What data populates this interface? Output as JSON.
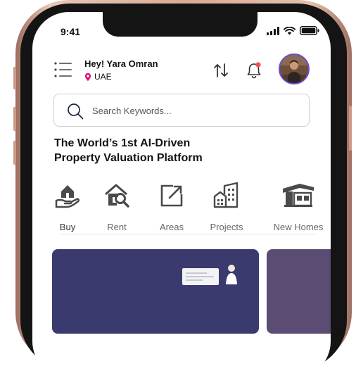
{
  "status_bar": {
    "time": "9:41"
  },
  "header": {
    "greeting": "Hey! Yara Omran",
    "location": "UAE"
  },
  "search": {
    "placeholder": "Search Keywords..."
  },
  "headline": {
    "line1": "The World’s 1st AI-Driven",
    "line2": "Property Valuation Platform"
  },
  "categories": [
    {
      "label": "Buy",
      "icon": "hand-house-icon"
    },
    {
      "label": "Rent",
      "icon": "house-search-icon"
    },
    {
      "label": "Areas",
      "icon": "expand-arrow-icon"
    },
    {
      "label": "Projects",
      "icon": "buildings-icon"
    },
    {
      "label": "New Homes",
      "icon": "new-home-icon"
    }
  ],
  "colors": {
    "accent": "#6b4bd1",
    "notification_dot": "#ef5350",
    "card_primary": "#3b3a6e",
    "card_secondary": "#5b4c73",
    "phone_frame": "#d8ad98"
  }
}
